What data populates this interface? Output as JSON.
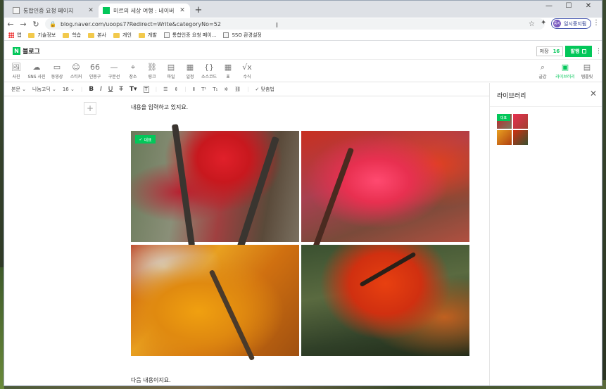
{
  "tabs": [
    {
      "title": "통합인증 요청 페이지",
      "active": false
    },
    {
      "title": "미르의 세상 여행 : 네이버 블로...",
      "active": true
    }
  ],
  "window_controls": {
    "minimize": "—",
    "maximize": "☐",
    "close": "✕"
  },
  "address": {
    "url": "blog.naver.com/uoops7?Redirect=Write&categoryNo=52",
    "profile_label": "일시중지됨",
    "profile_avatar": "중지"
  },
  "bookmarks": [
    {
      "label": "앱",
      "type": "apps"
    },
    {
      "label": "기술정보",
      "type": "folder"
    },
    {
      "label": "학습",
      "type": "folder"
    },
    {
      "label": "본사",
      "type": "folder"
    },
    {
      "label": "개인",
      "type": "folder"
    },
    {
      "label": "개발",
      "type": "folder"
    },
    {
      "label": "통합인증 요청 페이...",
      "type": "page"
    },
    {
      "label": "SSO 환경설정",
      "type": "page"
    }
  ],
  "blog": {
    "logo": "N",
    "title": "블로그",
    "save_label": "저장",
    "save_count": "16",
    "publish_label": "발행"
  },
  "insert_toolbar": [
    {
      "label": "사진",
      "icon": "🖼"
    },
    {
      "label": "SNS 사진",
      "icon": "☁"
    },
    {
      "label": "동영상",
      "icon": "▭"
    },
    {
      "label": "스티커",
      "icon": "☺"
    },
    {
      "label": "인용구",
      "icon": "66"
    },
    {
      "label": "구분선",
      "icon": "—"
    },
    {
      "label": "장소",
      "icon": "⌖"
    },
    {
      "label": "링크",
      "icon": "⛓"
    },
    {
      "label": "파일",
      "icon": "▤"
    },
    {
      "label": "일정",
      "icon": "▦"
    },
    {
      "label": "소스코드",
      "icon": "{}"
    },
    {
      "label": "표",
      "icon": "▦"
    },
    {
      "label": "수식",
      "icon": "√x"
    }
  ],
  "right_tools": [
    {
      "label": "글감",
      "icon": "⌕"
    },
    {
      "label": "라이브러리",
      "icon": "▣",
      "active": true
    },
    {
      "label": "템플릿",
      "icon": "▤"
    }
  ],
  "format_toolbar": {
    "style": "본문",
    "font": "나눔고딕",
    "size": "16",
    "spellcheck": "맞춤법"
  },
  "editor": {
    "line1": "내용을 입력하고 있지요.",
    "line2": "다음 내용이지요.",
    "badge": "대표"
  },
  "library": {
    "title": "라이브러리",
    "badge": "대표"
  },
  "colors": {
    "accent": "#03c75a"
  }
}
